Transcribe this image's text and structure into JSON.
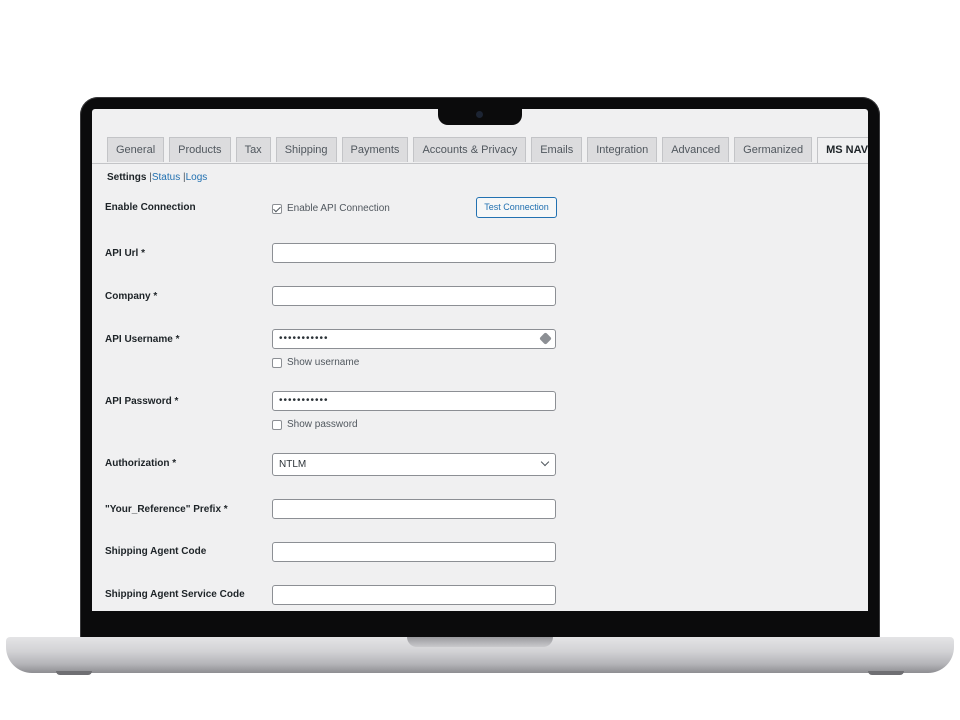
{
  "tabs": [
    {
      "label": "General"
    },
    {
      "label": "Products"
    },
    {
      "label": "Tax"
    },
    {
      "label": "Shipping"
    },
    {
      "label": "Payments"
    },
    {
      "label": "Accounts & Privacy"
    },
    {
      "label": "Emails"
    },
    {
      "label": "Integration"
    },
    {
      "label": "Advanced"
    },
    {
      "label": "Germanized"
    },
    {
      "label": "MS NAV Sync",
      "active": true
    }
  ],
  "subnav": {
    "settings": "Settings",
    "status": "Status",
    "logs": "Logs",
    "sep": "|"
  },
  "form": {
    "enable_connection": {
      "label": "Enable Connection",
      "checkbox_label": "Enable API Connection",
      "checked": true,
      "test_button": "Test Connection"
    },
    "api_url": {
      "label": "API Url *",
      "value": ""
    },
    "company": {
      "label": "Company *",
      "value": ""
    },
    "api_username": {
      "label": "API Username *",
      "value": "•••••••••••",
      "show_label": "Show username",
      "show_checked": false
    },
    "api_password": {
      "label": "API Password *",
      "value": "•••••••••••",
      "show_label": "Show password",
      "show_checked": false
    },
    "authorization": {
      "label": "Authorization *",
      "selected": "NTLM"
    },
    "your_reference_prefix": {
      "label": "\"Your_Reference\" Prefix *",
      "value": ""
    },
    "shipping_agent_code": {
      "label": "Shipping Agent Code",
      "value": ""
    },
    "shipping_agent_service_code": {
      "label": "Shipping Agent Service Code",
      "value": ""
    }
  },
  "colors": {
    "link": "#2271b1",
    "background": "#f0f0f1",
    "border": "#8c8f94"
  }
}
